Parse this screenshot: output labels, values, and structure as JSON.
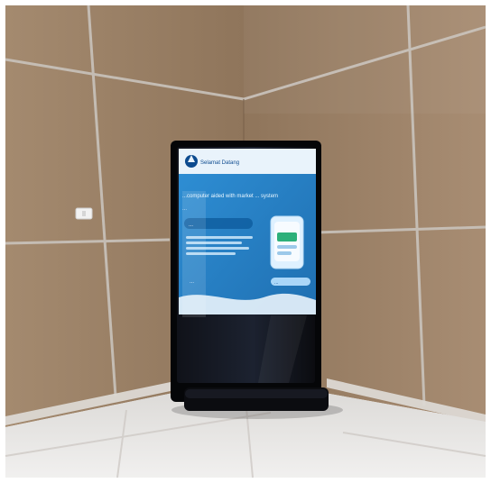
{
  "scene": {
    "kiosk_screen": {
      "header_text": "Selamat Datang",
      "headline": "...computer aided with market ... system",
      "subtitle": "...",
      "cta_label": "...",
      "link_text": "...",
      "bottom_text": "...",
      "right_button_text": "..."
    },
    "colors": {
      "wall_wood": "#9c7f63",
      "wall_wood_dark": "#836a52",
      "floor": "#e9e7e4",
      "kiosk_body": "#0a0b0f",
      "screen_blue": "#2a86c9",
      "screen_light": "#e9f3fb"
    }
  }
}
